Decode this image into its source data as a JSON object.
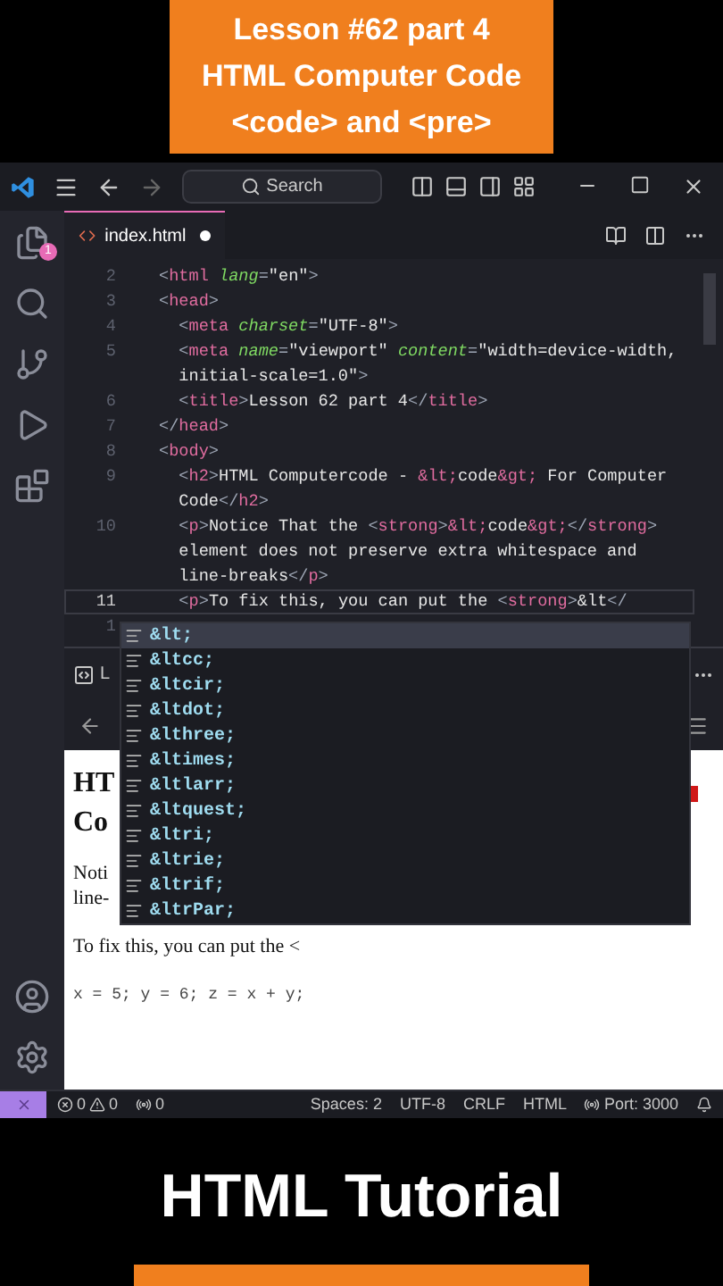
{
  "banner": {
    "lines": [
      "Lesson #62 part 4",
      "HTML Computer Code",
      "<code> and <pre>"
    ]
  },
  "titlebar": {
    "search": {
      "placeholder": "Search"
    }
  },
  "activity_bar": {
    "explorer_badge": "1"
  },
  "editor_tab": {
    "label": "index.html",
    "modified": true
  },
  "code_rows": [
    {
      "number": "2",
      "current": false,
      "tokens": [
        {
          "kind": "p",
          "text": "<"
        },
        {
          "kind": "t",
          "text": "html"
        },
        {
          "kind": "a",
          "text": " lang"
        },
        {
          "kind": "p",
          "text": "="
        },
        {
          "kind": "s",
          "text": "\"en\""
        },
        {
          "kind": "p",
          "text": ">"
        }
      ]
    },
    {
      "number": "3",
      "current": false,
      "tokens": [
        {
          "kind": "p",
          "text": "<"
        },
        {
          "kind": "t",
          "text": "head"
        },
        {
          "kind": "p",
          "text": ">"
        }
      ]
    },
    {
      "number": "4",
      "current": false,
      "tokens": [
        {
          "kind": "p",
          "text": "  <"
        },
        {
          "kind": "t",
          "text": "meta"
        },
        {
          "kind": "a",
          "text": " charset"
        },
        {
          "kind": "p",
          "text": "="
        },
        {
          "kind": "s",
          "text": "\"UTF-8\""
        },
        {
          "kind": "p",
          "text": ">"
        }
      ]
    },
    {
      "number": "5",
      "current": false,
      "tokens": [
        {
          "kind": "p",
          "text": "  <"
        },
        {
          "kind": "t",
          "text": "meta"
        },
        {
          "kind": "a",
          "text": " name"
        },
        {
          "kind": "p",
          "text": "="
        },
        {
          "kind": "s",
          "text": "\"viewport\""
        },
        {
          "kind": "a",
          "text": " content"
        },
        {
          "kind": "p",
          "text": "="
        },
        {
          "kind": "s",
          "text": "\"width=device-width,"
        }
      ]
    },
    {
      "current": false,
      "tokens": [
        {
          "kind": "s",
          "text": "  initial-scale=1.0\""
        },
        {
          "kind": "p",
          "text": ">"
        }
      ]
    },
    {
      "number": "6",
      "current": false,
      "tokens": [
        {
          "kind": "p",
          "text": "  <"
        },
        {
          "kind": "t",
          "text": "title"
        },
        {
          "kind": "p",
          "text": ">"
        },
        {
          "kind": "x",
          "text": "Lesson 62 part 4"
        },
        {
          "kind": "p",
          "text": "</"
        },
        {
          "kind": "t",
          "text": "title"
        },
        {
          "kind": "p",
          "text": ">"
        }
      ]
    },
    {
      "number": "7",
      "current": false,
      "tokens": [
        {
          "kind": "p",
          "text": "</"
        },
        {
          "kind": "t",
          "text": "head"
        },
        {
          "kind": "p",
          "text": ">"
        }
      ]
    },
    {
      "number": "8",
      "current": false,
      "tokens": [
        {
          "kind": "p",
          "text": "<"
        },
        {
          "kind": "t",
          "text": "body"
        },
        {
          "kind": "p",
          "text": ">"
        }
      ]
    },
    {
      "number": "9",
      "current": false,
      "tokens": [
        {
          "kind": "p",
          "text": "  <"
        },
        {
          "kind": "t",
          "text": "h2"
        },
        {
          "kind": "p",
          "text": ">"
        },
        {
          "kind": "x",
          "text": "HTML Computercode - "
        },
        {
          "kind": "e",
          "text": "&lt;"
        },
        {
          "kind": "x",
          "text": "code"
        },
        {
          "kind": "e",
          "text": "&gt;"
        },
        {
          "kind": "x",
          "text": " For Computer"
        }
      ]
    },
    {
      "current": false,
      "tokens": [
        {
          "kind": "x",
          "text": "  Code"
        },
        {
          "kind": "p",
          "text": "</"
        },
        {
          "kind": "t",
          "text": "h2"
        },
        {
          "kind": "p",
          "text": ">"
        }
      ]
    },
    {
      "number": "10",
      "current": false,
      "tokens": [
        {
          "kind": "p",
          "text": "  <"
        },
        {
          "kind": "t",
          "text": "p"
        },
        {
          "kind": "p",
          "text": ">"
        },
        {
          "kind": "x",
          "text": "Notice That the "
        },
        {
          "kind": "p",
          "text": "<"
        },
        {
          "kind": "t",
          "text": "strong"
        },
        {
          "kind": "p",
          "text": ">"
        },
        {
          "kind": "e",
          "text": "&lt;"
        },
        {
          "kind": "x",
          "text": "code"
        },
        {
          "kind": "e",
          "text": "&gt;"
        },
        {
          "kind": "p",
          "text": "</"
        },
        {
          "kind": "t",
          "text": "strong"
        },
        {
          "kind": "p",
          "text": ">"
        }
      ]
    },
    {
      "current": false,
      "tokens": [
        {
          "kind": "x",
          "text": "  element does not preserve extra whitespace and"
        }
      ]
    },
    {
      "current": false,
      "tokens": [
        {
          "kind": "x",
          "text": "  line-breaks"
        },
        {
          "kind": "p",
          "text": "</"
        },
        {
          "kind": "t",
          "text": "p"
        },
        {
          "kind": "p",
          "text": ">"
        }
      ]
    },
    {
      "number": "11",
      "current": true,
      "tokens": [
        {
          "kind": "p",
          "text": "  <"
        },
        {
          "kind": "t",
          "text": "p"
        },
        {
          "kind": "p",
          "text": ">"
        },
        {
          "kind": "x",
          "text": "To fix this, you can put the "
        },
        {
          "kind": "p",
          "text": "<"
        },
        {
          "kind": "t",
          "text": "strong"
        },
        {
          "kind": "p",
          "text": ">"
        },
        {
          "kind": "x",
          "text": "&lt"
        },
        {
          "kind": "p",
          "text": "</"
        }
      ]
    },
    {
      "number": "1",
      "current": false,
      "tokens": []
    }
  ],
  "suggestions": [
    {
      "label": "&lt;",
      "selected": true
    },
    {
      "label": "&ltcc;",
      "selected": false
    },
    {
      "label": "&ltcir;",
      "selected": false
    },
    {
      "label": "&ltdot;",
      "selected": false
    },
    {
      "label": "&lthree;",
      "selected": false
    },
    {
      "label": "&ltimes;",
      "selected": false
    },
    {
      "label": "&ltlarr;",
      "selected": false
    },
    {
      "label": "&ltquest;",
      "selected": false
    },
    {
      "label": "&ltri;",
      "selected": false
    },
    {
      "label": "&ltrie;",
      "selected": false
    },
    {
      "label": "&ltrif;",
      "selected": false
    },
    {
      "label": "&ltrPar;",
      "selected": false
    }
  ],
  "panel": {
    "title": "L"
  },
  "preview": {
    "heading_fragments": [
      "HT",
      "Co"
    ],
    "paragraph_fragments": [
      "Noti",
      "line-"
    ],
    "paragraph": "To fix this, you can put the <",
    "code": "x = 5; y = 6; z = x + y;"
  },
  "status_bar": {
    "errors": "0",
    "warnings": "0",
    "ports_count": "0",
    "items": [
      "Spaces: 2",
      "UTF-8",
      "CRLF",
      "HTML"
    ],
    "port": "Port: 3000"
  },
  "footer": {
    "title": "HTML Tutorial"
  }
}
